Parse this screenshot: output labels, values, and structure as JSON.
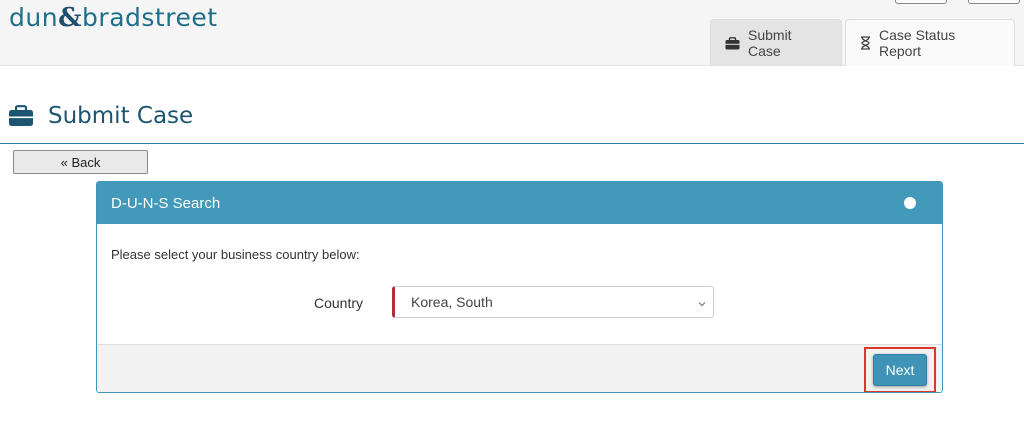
{
  "brand": {
    "part1": "dun",
    "amp": "&",
    "part2": "bradstreet",
    "color": "#1e6f8a"
  },
  "tabs": [
    {
      "label": "Submit Case",
      "icon": "briefcase-icon",
      "active": true
    },
    {
      "label": "Case Status Report",
      "icon": "hourglass-icon",
      "active": false
    }
  ],
  "page": {
    "title": "Submit Case",
    "title_icon": "briefcase-icon",
    "back_label": "« Back"
  },
  "panel": {
    "title": "D-U-N-S Search",
    "prompt": "Please select your business country below:",
    "country_label": "Country",
    "country_value": "Korea, South",
    "next_label": "Next"
  },
  "colors": {
    "panel_header": "#4299ba",
    "heading": "#1c5570",
    "required_marker": "#b0303a",
    "highlight": "#d9382b"
  }
}
